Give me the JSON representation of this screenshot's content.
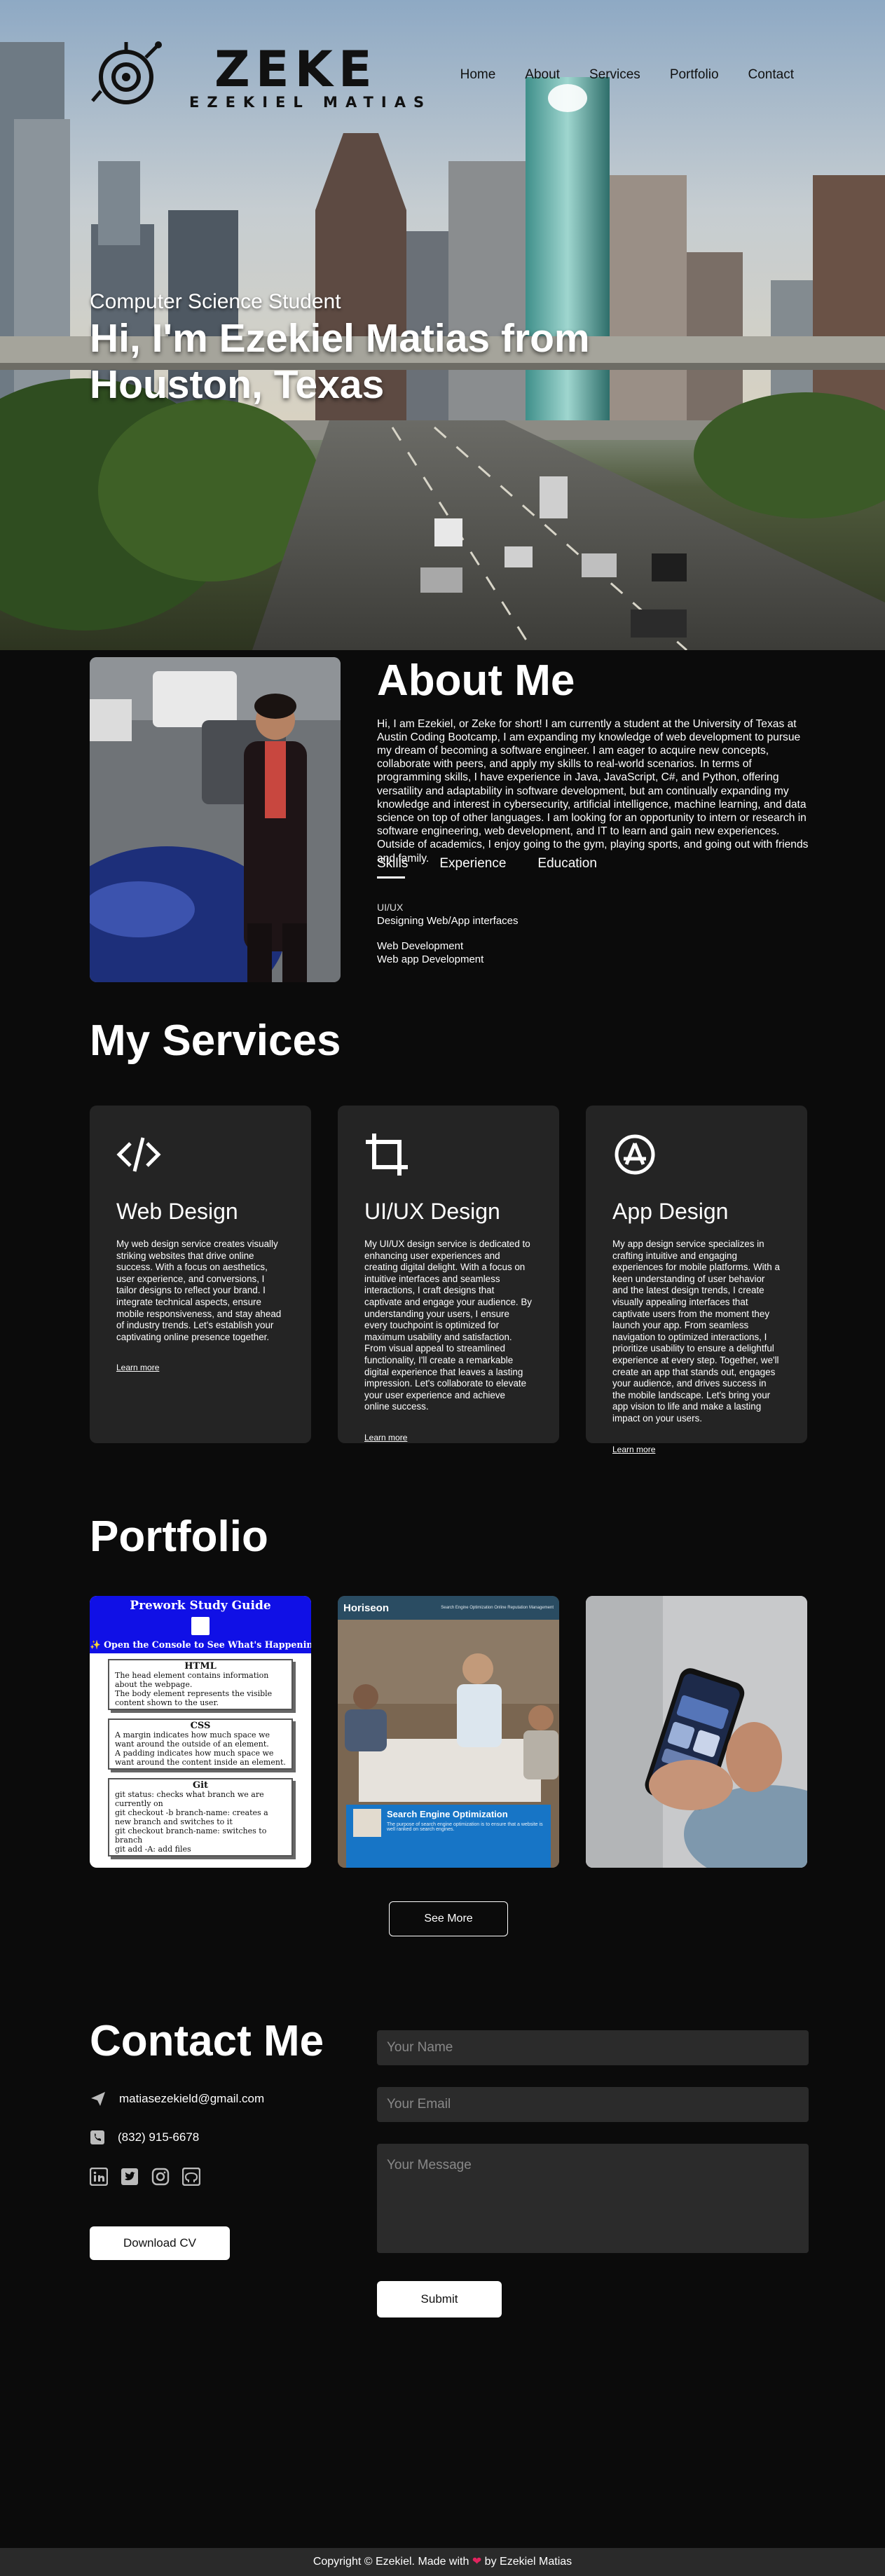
{
  "brand": {
    "logo_big": "ZEKE",
    "logo_small": "EZEKIEL MATIAS"
  },
  "nav": [
    "Home",
    "About",
    "Services",
    "Portfolio",
    "Contact"
  ],
  "hero": {
    "subtitle": "Computer Science Student",
    "title": "Hi, I'm Ezekiel Matias from Houston, Texas"
  },
  "about": {
    "title": "About Me",
    "text": "Hi, I am Ezekiel, or Zeke for short! I am currently a student at the University of Texas at Austin Coding Bootcamp, I am expanding my knowledge of web development to pursue my dream of becoming a software engineer. I am eager to acquire new concepts, collaborate with peers, and apply my skills to real-world scenarios. In terms of programming skills, I have experience in Java, JavaScript, C#, and Python, offering versatility and adaptability in software development, but am continually expanding my knowledge and interest in cybersecurity, artificial intelligence, machine learning, and data science on top of other languages. I am looking for an opportunity to intern or research in software engineering, web development, and IT to learn and gain new experiences. Outside of academics, I enjoy going to the gym, playing sports, and going out with friends and family.",
    "tabs": [
      "Skills",
      "Experience",
      "Education"
    ],
    "skills": [
      {
        "name": "UI/UX",
        "desc": "Designing Web/App interfaces"
      },
      {
        "name": "Web Development",
        "desc": "Web app Development"
      }
    ]
  },
  "services": {
    "title": "My Services",
    "cards": [
      {
        "icon": "code-icon",
        "title": "Web Design",
        "text": "My web design service creates visually striking websites that drive online success. With a focus on aesthetics, user experience, and conversions, I tailor designs to reflect your brand. I integrate technical aspects, ensure mobile responsiveness, and stay ahead of industry trends. Let's establish your captivating online presence together.",
        "link": "Learn more"
      },
      {
        "icon": "crop-icon",
        "title": "UI/UX Design",
        "text": "My UI/UX design service is dedicated to enhancing user experiences and creating digital delight. With a focus on intuitive interfaces and seamless interactions, I craft designs that captivate and engage your audience. By understanding your users, I ensure every touchpoint is optimized for maximum usability and satisfaction. From visual appeal to streamlined functionality, I'll create a remarkable digital experience that leaves a lasting impression. Let's collaborate to elevate your user experience and achieve online success.",
        "link": "Learn more"
      },
      {
        "icon": "app-store-icon",
        "title": "App Design",
        "text": "My app design service specializes in crafting intuitive and engaging experiences for mobile platforms. With a keen understanding of user behavior and the latest design trends, I create visually appealing interfaces that captivate users from the moment they launch your app. From seamless navigation to optimized interactions, I prioritize usability to ensure a delightful experience at every step. Together, we'll create an app that stands out, engages your audience, and drives success in the mobile landscape. Let's bring your app vision to life and make a lasting impact on your users.",
        "link": "Learn more"
      }
    ]
  },
  "portfolio": {
    "title": "Portfolio",
    "items": [
      {
        "header": "Prework Study Guide",
        "banner": "✨ Open the Console to See What's Happening ✨",
        "sections": [
          {
            "title": "HTML",
            "lines": [
              "The head element contains information about the webpage.",
              "The body element represents the visible content shown to the user."
            ]
          },
          {
            "title": "CSS",
            "lines": [
              "A margin indicates how much space we want around the outside of an element.",
              "A padding indicates how much space we want around the content inside an element."
            ]
          },
          {
            "title": "Git",
            "lines": [
              "git status: checks what branch we are currently on",
              "git checkout -b branch-name: creates a new branch and switches to it",
              "git checkout branch-name: switches to branch",
              "git add -A: add files"
            ]
          }
        ]
      },
      {
        "brand": "Horiseon",
        "nav": "Search Engine Optimization   Online Reputation Management",
        "box_title": "Search Engine Optimization",
        "box_text": "The purpose of search engine optimization is to ensure that a website is well ranked on search engines."
      },
      {
        "label": ""
      }
    ],
    "see_more": "See More"
  },
  "contact": {
    "title": "Contact Me",
    "email": "matiasezekield@gmail.com",
    "phone": "(832) 915-6678",
    "social": [
      "linkedin-icon",
      "twitter-icon",
      "instagram-icon",
      "github-icon"
    ],
    "download": "Download CV",
    "placeholders": {
      "name": "Your Name",
      "email": "Your Email",
      "message": "Your Message"
    },
    "submit": "Submit"
  },
  "footer": {
    "before": "Copyright © Ezekiel. Made with",
    "heart": "❤",
    "after": "by Ezekiel Matias"
  },
  "colors": {
    "background": "#0b0b0b",
    "card": "#242424",
    "field": "#2b2b2b",
    "accent": "#ffffff"
  }
}
